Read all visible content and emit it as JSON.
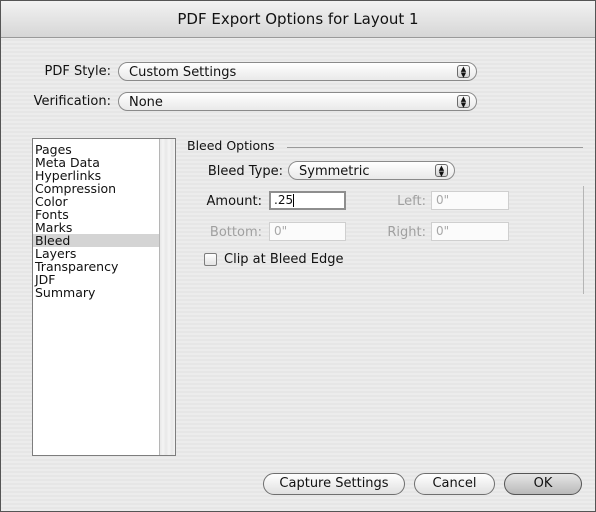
{
  "window": {
    "title": "PDF Export Options for Layout 1"
  },
  "pdf_style": {
    "label": "PDF Style:",
    "value": "Custom Settings"
  },
  "verification": {
    "label": "Verification:",
    "value": "None"
  },
  "sidebar": {
    "items": [
      {
        "label": "Pages"
      },
      {
        "label": "Meta Data"
      },
      {
        "label": "Hyperlinks"
      },
      {
        "label": "Compression"
      },
      {
        "label": "Color"
      },
      {
        "label": "Fonts"
      },
      {
        "label": "Marks"
      },
      {
        "label": "Bleed",
        "selected": true
      },
      {
        "label": "Layers"
      },
      {
        "label": "Transparency"
      },
      {
        "label": "JDF"
      },
      {
        "label": "Summary"
      }
    ]
  },
  "bleed": {
    "group_title": "Bleed Options",
    "type_label": "Bleed Type:",
    "type_value": "Symmetric",
    "amount_label": "Amount:",
    "amount_value": ".25",
    "left_label": "Left:",
    "left_value": "0\"",
    "bottom_label": "Bottom:",
    "bottom_value": "0\"",
    "right_label": "Right:",
    "right_value": "0\"",
    "clip_label": "Clip at Bleed Edge",
    "clip_checked": false
  },
  "buttons": {
    "capture": "Capture Settings",
    "cancel": "Cancel",
    "ok": "OK"
  },
  "icons": {
    "popup_arrows": "up-down-arrows-icon"
  }
}
